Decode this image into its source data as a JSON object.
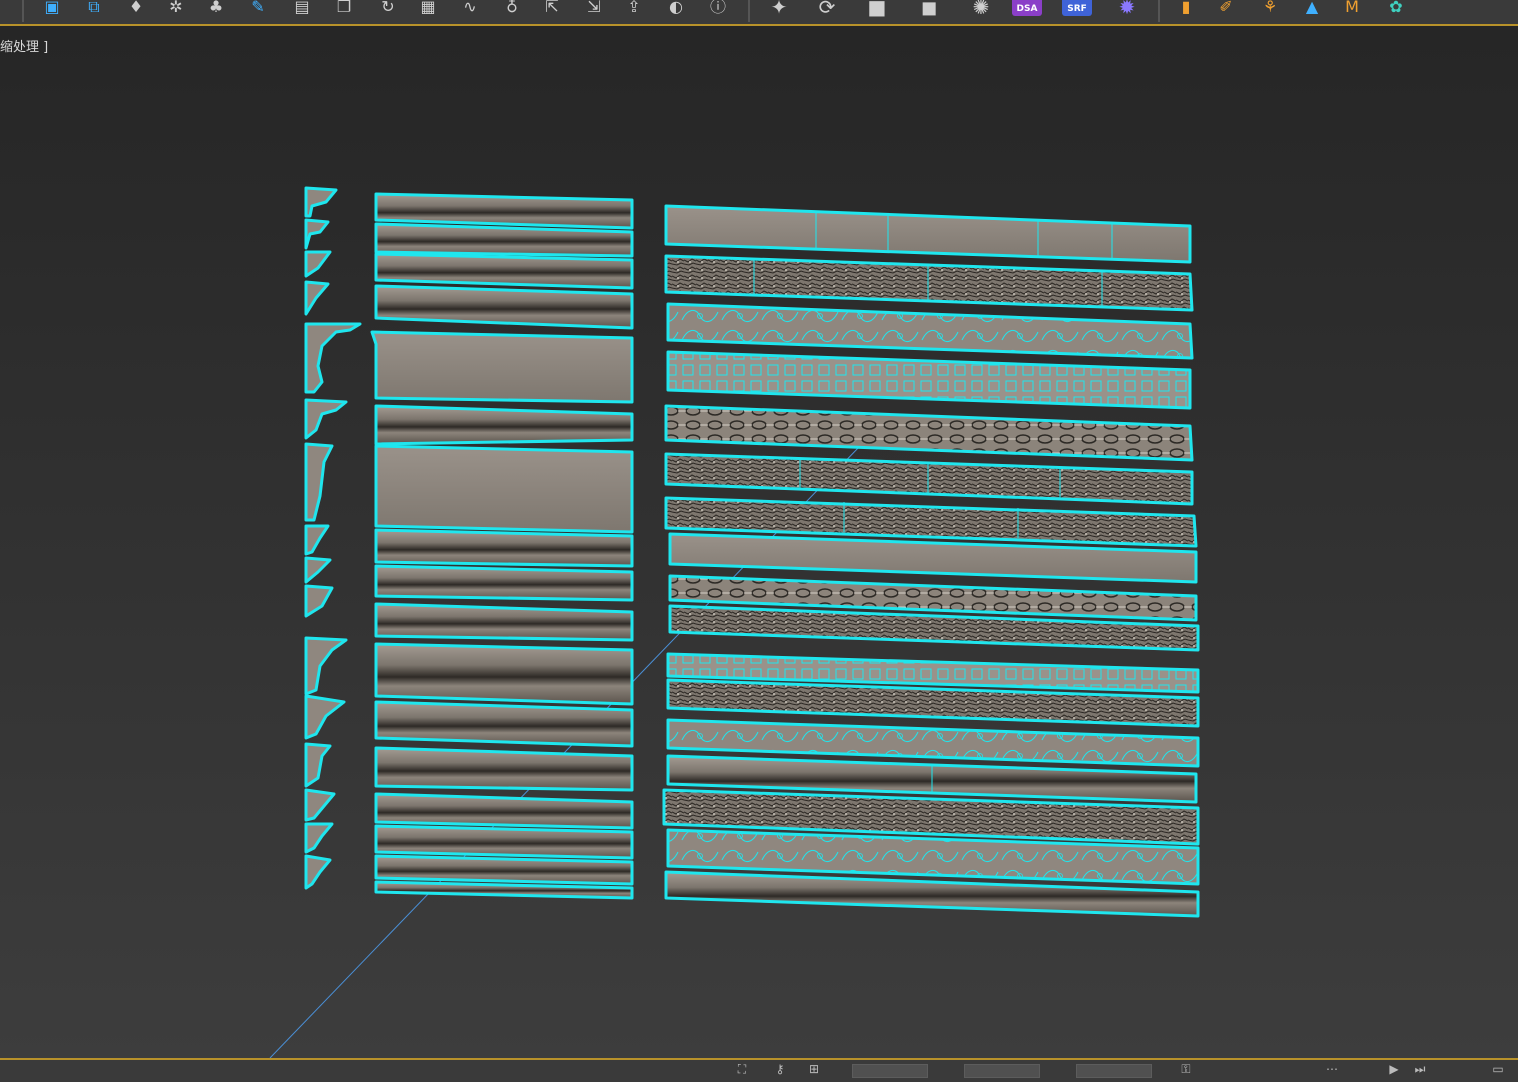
{
  "viewport": {
    "label": "缩处理 ]"
  },
  "toolbar": {
    "badge_a": "DSA",
    "badge_b": "SRF",
    "icons": [
      "save-icon",
      "link-icon",
      "light-icon",
      "gear-icon",
      "tree-icon",
      "edit-icon",
      "document-icon",
      "copy-icon",
      "rotate-icon",
      "layers-icon",
      "curve-icon",
      "bulb-icon",
      "export-icon",
      "import-icon",
      "share-icon",
      "sphere-icon",
      "help-icon",
      "render-teapot-icon",
      "refresh-icon",
      "camera-icon",
      "sun-icon",
      "settings-icon",
      "chart-icon",
      "palette-icon",
      "graph-icon",
      "user-icon",
      "material-icon",
      "plugin-icon"
    ]
  },
  "statusbar": {
    "fields": [
      "",
      "",
      ""
    ]
  },
  "colors": {
    "selection": "#1fe6ee",
    "molding": "#8f877f",
    "molding_dark": "#3a3630",
    "toolbar_accent": "#b8922a"
  }
}
